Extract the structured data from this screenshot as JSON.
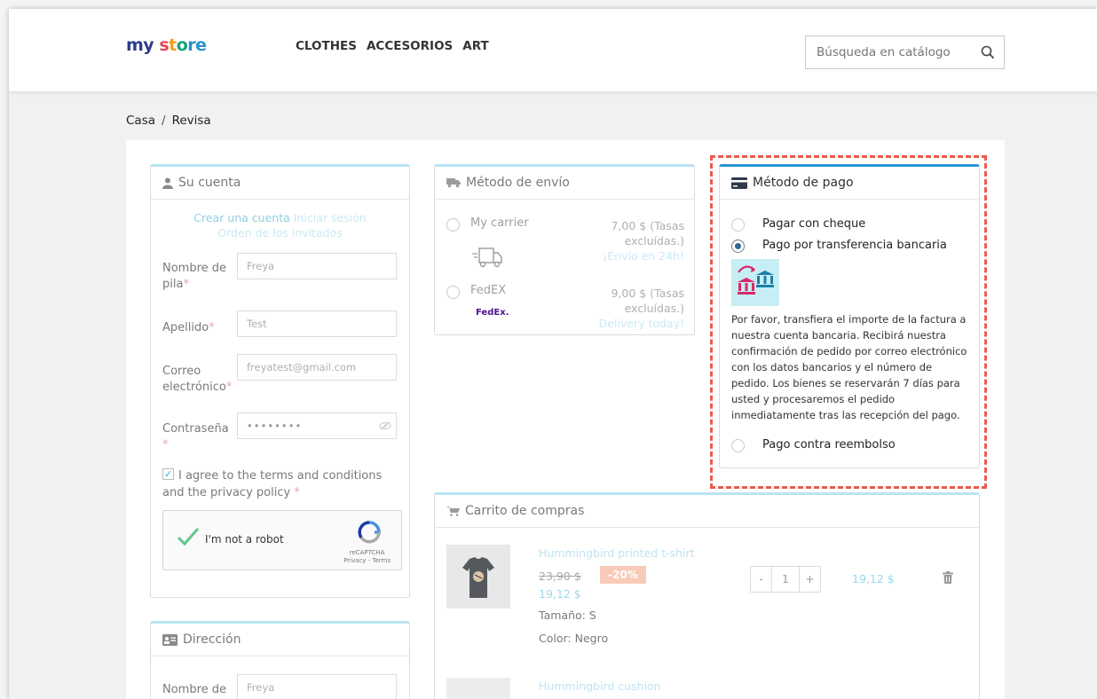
{
  "header": {
    "logo": {
      "p1": "my",
      "p2": "s",
      "p3": "t",
      "p4": "o",
      "p5": "re"
    },
    "nav": [
      "CLOTHES",
      "ACCESORIOS",
      "ART"
    ],
    "search_placeholder": "Búsqueda en catálogo"
  },
  "breadcrumb": {
    "home": "Casa",
    "sep": "/",
    "current": "Revisa"
  },
  "account": {
    "title": "Su cuenta",
    "links": {
      "create": "Crear una cuenta",
      "login": "Iniciar sesión",
      "guest": "Orden de los invitados"
    },
    "first_name": {
      "label": "Nombre de pila",
      "value": "Freya"
    },
    "last_name": {
      "label": "Apellido",
      "value": "Test"
    },
    "email": {
      "label": "Correo electrónico",
      "value": "freyatest@gmail.com"
    },
    "password": {
      "label": "Contraseña",
      "value": "••••••••"
    },
    "required_mark": "*",
    "terms": "I agree to the terms and conditions and the privacy policy",
    "captcha": {
      "label": "I'm not a robot",
      "brand": "reCAPTCHA",
      "links": "Privacy - Terms"
    }
  },
  "address": {
    "title": "Dirección",
    "first_name": {
      "label": "Nombre de",
      "value": "Freya"
    }
  },
  "shipping": {
    "title": "Método de envío",
    "carriers": [
      {
        "name": "My carrier",
        "price": "7,00 $ (Tasas excluídas.)",
        "delay": "¡Envío en 24h!"
      },
      {
        "name": "FedEX",
        "price": "9,00 $ (Tasas excluídas.)",
        "delay": "Delivery today!",
        "logo": "FedEx."
      }
    ]
  },
  "payment": {
    "title": "Método de pago",
    "options": [
      "Pagar con cheque",
      "Pago por transferencia bancaria",
      "Pago contra reembolso"
    ],
    "selected": 1,
    "description": "Por favor, transfiera el importe de la factura a nuestra cuenta bancaria. Recibirá nuestra confirmación de pedido por correo electrónico con los datos bancarios y el número de pedido. Los bienes se reservarán 7 días para usted y procesaremos el pedido inmediatamente tras las recepción del pago."
  },
  "cart": {
    "title": "Carrito de compras",
    "items": [
      {
        "name": "Hummingbird printed t-shirt",
        "old_price": "23,90 $",
        "discount": "-20%",
        "price": "19,12 $",
        "size": "Tamaño: S",
        "color": "Color: Negro",
        "qty": "1",
        "total": "19,12 $"
      },
      {
        "name": "Hummingbird cushion"
      }
    ],
    "minus": "-",
    "plus": "+"
  },
  "colors": {
    "accent": "#25b9d7",
    "payment_border": "#2a96d7",
    "highlight": "#ec5a4f"
  }
}
